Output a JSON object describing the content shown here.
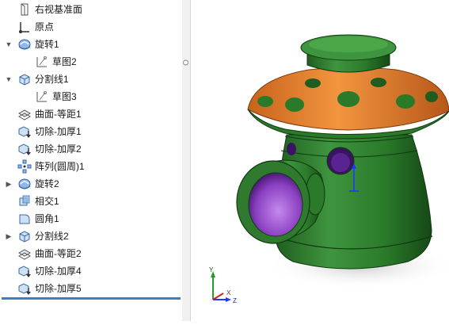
{
  "feature_tree": {
    "items": [
      {
        "label": "右视基准面",
        "icon": "plane-icon",
        "expander": ""
      },
      {
        "label": "原点",
        "icon": "origin-icon",
        "expander": ""
      },
      {
        "label": "旋转1",
        "icon": "revolve-icon",
        "expander": "▼"
      },
      {
        "label": "草图2",
        "icon": "sketch-icon",
        "expander": ""
      },
      {
        "label": "分割线1",
        "icon": "split-line-icon",
        "expander": "▼"
      },
      {
        "label": "草图3",
        "icon": "sketch-icon",
        "expander": ""
      },
      {
        "label": "曲面-等距1",
        "icon": "offset-surface-icon",
        "expander": ""
      },
      {
        "label": "切除-加厚1",
        "icon": "thicken-cut-icon",
        "expander": ""
      },
      {
        "label": "切除-加厚2",
        "icon": "thicken-cut-icon",
        "expander": ""
      },
      {
        "label": "阵列(圆周)1",
        "icon": "circular-pattern-icon",
        "expander": ""
      },
      {
        "label": "旋转2",
        "icon": "revolve-icon",
        "expander": "▶"
      },
      {
        "label": "相交1",
        "icon": "intersect-icon",
        "expander": ""
      },
      {
        "label": "圆角1",
        "icon": "fillet-icon",
        "expander": ""
      },
      {
        "label": "分割线2",
        "icon": "split-line-icon",
        "expander": "▶"
      },
      {
        "label": "曲面-等距2",
        "icon": "offset-surface-icon",
        "expander": ""
      },
      {
        "label": "切除-加厚4",
        "icon": "thicken-cut-icon",
        "expander": ""
      },
      {
        "label": "切除-加厚5",
        "icon": "thicken-cut-icon",
        "expander": ""
      }
    ]
  },
  "triad": {
    "x": "X",
    "y": "Y",
    "z": "Z"
  },
  "colors": {
    "body": "#2f7a2f",
    "roof": "#e8802a",
    "accent": "#3b7fc4",
    "interior": "#8a3fc0"
  }
}
